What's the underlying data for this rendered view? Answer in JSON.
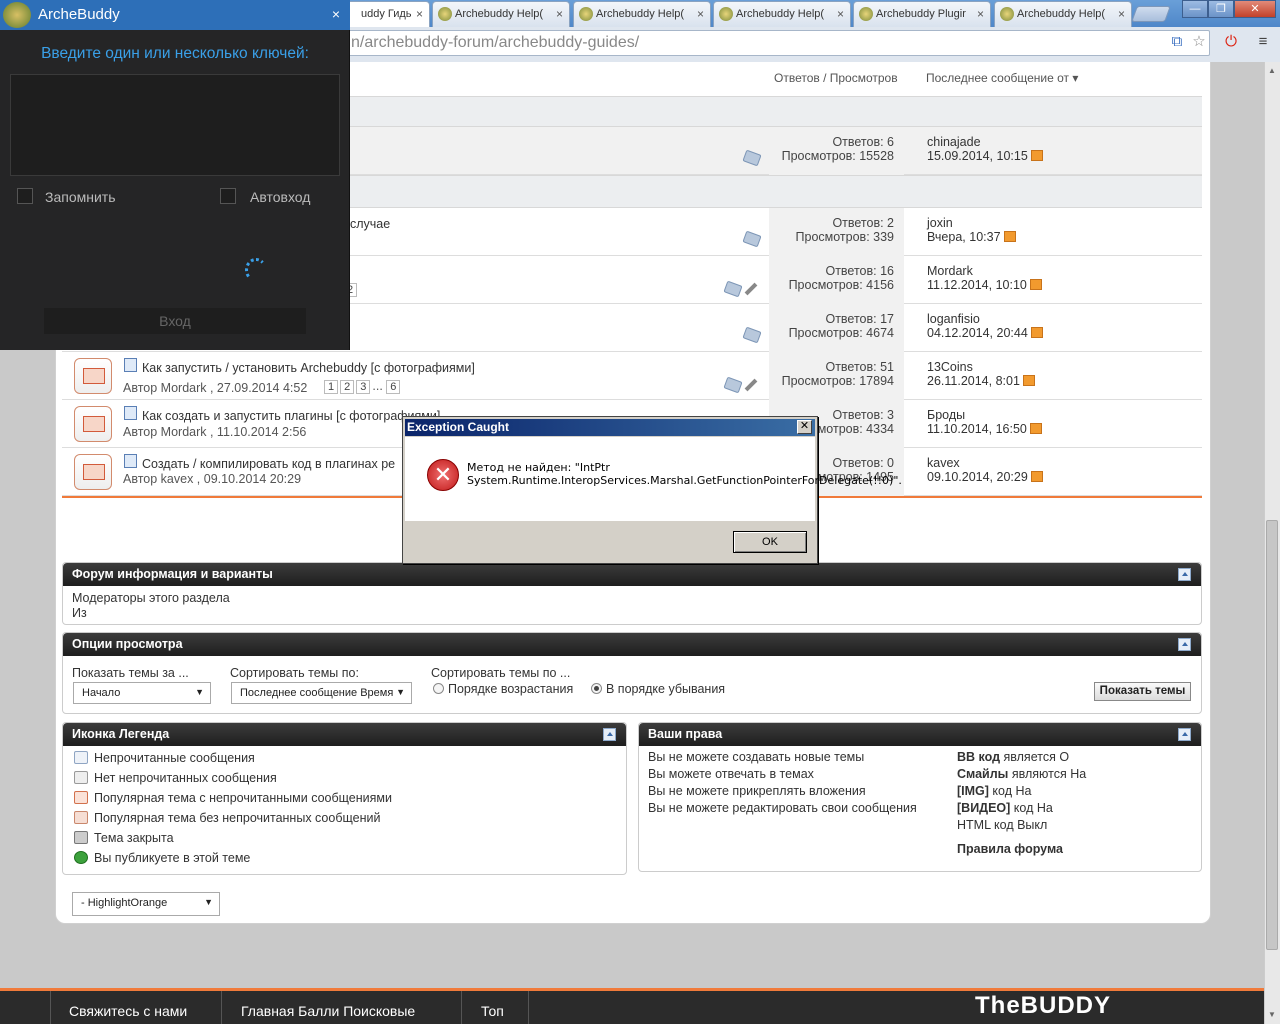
{
  "browser": {
    "tabs": [
      {
        "label": "uddy Гидь",
        "active": true
      },
      {
        "label": "Archebuddy Help(",
        "active": false
      },
      {
        "label": "Archebuddy Help(",
        "active": false
      },
      {
        "label": "Archebuddy Help(",
        "active": false
      },
      {
        "label": "Archebuddy Plugir",
        "active": false
      },
      {
        "label": "Archebuddy Help(",
        "active": false
      }
    ],
    "url": "n/archebuddy-forum/archebuddy-guides/",
    "win_min": "—",
    "win_max": "❐",
    "win_close": "✕"
  },
  "table": {
    "col_replies": "Ответов / Просмотров",
    "col_last": "Последнее сообщение от",
    "rows": [
      {
        "title": "",
        "sub": "",
        "replies": "Ответов: 6",
        "views": "Просмотров: 15528",
        "last_user": "chinajade",
        "last_date": "15.09.2014, 10:15"
      },
      {
        "title": "случае",
        "sub": "",
        "replies": "Ответов: 2",
        "views": "Просмотров: 339",
        "last_user": "joxin",
        "last_date": "Вчера, 10:37"
      },
      {
        "title": "",
        "sub": "2",
        "replies": "Ответов: 16",
        "views": "Просмотров: 4156",
        "last_user": "Mordark",
        "last_date": "11.12.2014, 10:10"
      },
      {
        "title": "",
        "sub": "",
        "replies": "Ответов: 17",
        "views": "Просмотров: 4674",
        "last_user": "loganfisio",
        "last_date": "04.12.2014, 20:44"
      },
      {
        "title": "Как запустить / установить Archebuddy [с фотографиями]",
        "sub": "Автор  Mordark , 27.09.2014 4:52",
        "replies": "Ответов: 51",
        "views": "Просмотров: 17894",
        "last_user": "13Coins",
        "last_date": "26.11.2014, 8:01"
      },
      {
        "title": "Как создать и запустить плагины [с фотографиями]",
        "sub": "Автор  Mordark , 11.10.2014 2:56",
        "replies": "Ответов: 3",
        "views": "Просмотров: 4334",
        "last_user": "Броды",
        "last_date": "11.10.2014, 16:50"
      },
      {
        "title": "Создать / компилировать код в плагинах ре",
        "sub": "Автор  kavex , 09.10.2014 20:29",
        "replies": "Ответов: 0",
        "views": "Просмотров: 1495",
        "last_user": "kavex",
        "last_date": "09.10.2014, 20:29"
      }
    ],
    "pages": [
      "1",
      "2",
      "3",
      "...",
      "6"
    ]
  },
  "forum_info": {
    "title": "Форум информация и варианты",
    "moderators": "Модераторы этого раздела",
    "of": "Из"
  },
  "view_options": {
    "title": "Опции просмотра",
    "show_label": "Показать темы за ...",
    "show_value": "Начало",
    "sort_label": "Сортировать темы по:",
    "sort_value": "Последнее сообщение Время",
    "order_label": "Сортировать темы по ...",
    "asc": "Порядке возрастания",
    "desc": "В порядке убывания",
    "show_button": "Показать темы"
  },
  "legend": {
    "title": "Иконка Легенда",
    "items": [
      "Непрочитанные сообщения",
      "Нет непрочитанных сообщения",
      "Популярная тема с непрочитанными сообщениями",
      "Популярная тема без непрочитанных сообщений",
      "Тема закрыта",
      "Вы публикуете в этой теме"
    ]
  },
  "rights": {
    "title": "Ваши права",
    "items": [
      "Вы не можете создавать новые темы",
      "Вы можете отвечать в темах",
      "Вы не можете прикреплять вложения",
      "Вы не можете редактировать свои сообщения"
    ],
    "codes": [
      {
        "name": "BB код",
        "state": "является О"
      },
      {
        "name": "Смайлы",
        "state": "являются На"
      },
      {
        "name": "[IMG]",
        "state": "код На"
      },
      {
        "name": "[ВИДЕО]",
        "state": "код На"
      },
      {
        "name": "",
        "state": "HTML код Выкл"
      }
    ],
    "rules": "Правила форума"
  },
  "style_select": "- HighlightOrange",
  "footer": {
    "items": [
      "Свяжитесь с нами",
      "Главная Балли Поисковые",
      "Топ"
    ],
    "logo": "TheBUDDY"
  },
  "archebuddy": {
    "title": "ArcheBuddy",
    "close": "×",
    "prompt": "Введите один или несколько ключей:",
    "remember": "Запомнить",
    "autologin": "Автовход",
    "login": "Вход"
  },
  "dialog": {
    "title": "Exception Caught",
    "close": "✕",
    "icon": "✕",
    "message": "Метод не найден: \"IntPtr System.Runtime.InteropServices.Marshal.GetFunctionPointerForDelegate(!!0)\".",
    "ok": "OK"
  }
}
